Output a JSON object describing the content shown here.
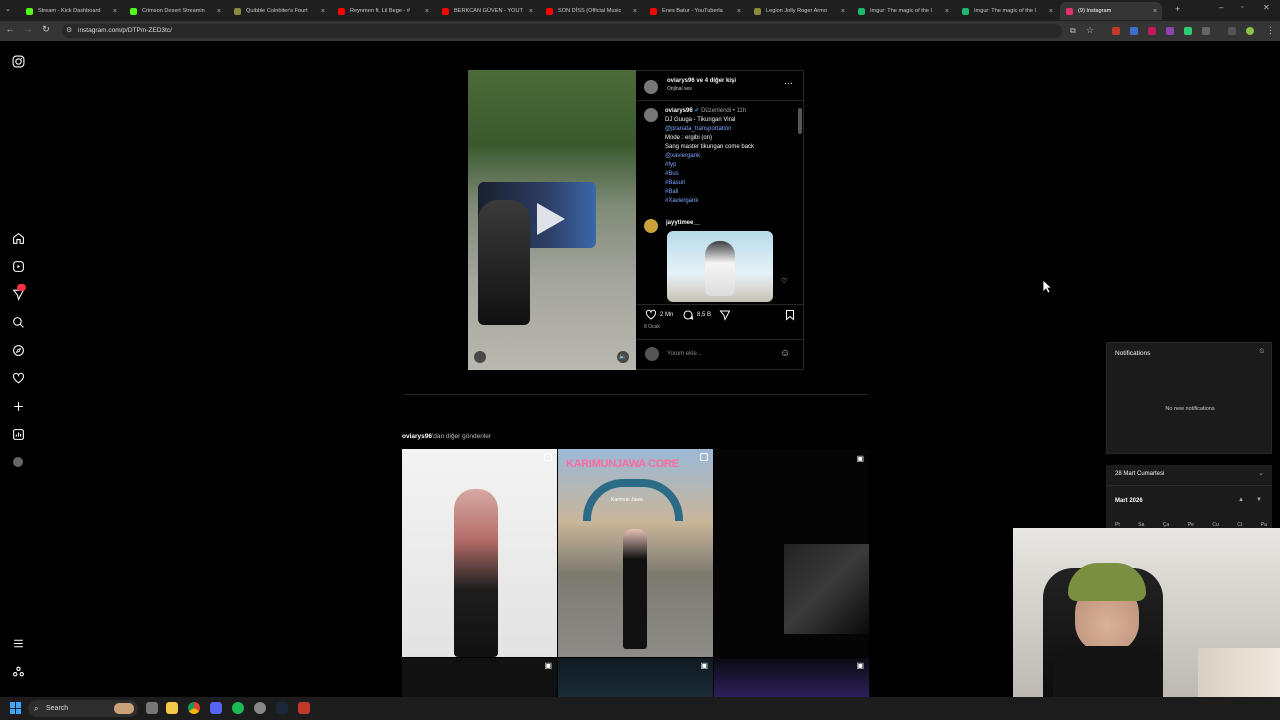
{
  "browser": {
    "tabs": [
      {
        "title": "Stream - Kick Dashboard",
        "color": "#53fc18"
      },
      {
        "title": "Crimson Desert Streamin",
        "color": "#53fc18"
      },
      {
        "title": "Quibble Colnbiter's Fourt",
        "color": "#8a8a3a"
      },
      {
        "title": "Reynmen ft. Lil Bege - #",
        "color": "#ff0000"
      },
      {
        "title": "BERKCAN GÜVEN - YOUT",
        "color": "#ff0000"
      },
      {
        "title": "SON DİSS (Official Music",
        "color": "#ff0000"
      },
      {
        "title": "Enes Batur - YouTuberla",
        "color": "#ff0000"
      },
      {
        "title": "Legion Jolly Roger Armo",
        "color": "#8a8a3a"
      },
      {
        "title": "Imgur: The magic of the I",
        "color": "#1bb76e"
      },
      {
        "title": "Imgur: The magic of the I",
        "color": "#1bb76e"
      },
      {
        "title": "(9) Instagram",
        "color": "#e1306c"
      }
    ],
    "url": "instagram.com/p/DTPm-ZED3tc/"
  },
  "post": {
    "header_user": "oviarys96 ve 4 diğer kişi",
    "header_sub": "Orijinal ses",
    "caption_user": "oviarys96",
    "caption_meta": "Düzenlendi • 11h",
    "caption_lines": [
      {
        "text": "DJ Guuga - Tikungan Viral",
        "link": false
      },
      {
        "text": "@pranata_transportation",
        "link": true
      },
      {
        "text": "Mode : ergibi (on)",
        "link": false
      },
      {
        "text": "Sang master tikungan come back",
        "link": false
      },
      {
        "text": "@xaviergank",
        "link": true
      },
      {
        "text": "#fyp",
        "link": true
      },
      {
        "text": "#Bus",
        "link": true
      },
      {
        "text": "#Basuri",
        "link": true
      },
      {
        "text": "#Bali",
        "link": true
      },
      {
        "text": "#Xaviergank",
        "link": true
      }
    ],
    "comment_user": "jayytimee__",
    "likes": "2 Mn",
    "comments": "8,5 B",
    "date": "8 Ocak",
    "comment_placeholder": "Yorum ekle..."
  },
  "more_posts": {
    "title_user": "oviarys96",
    "title_rest": "'dan diğer gönderiler",
    "banner_text": "KARIMUNJAWA CORE",
    "gate_text": "Karimun Jawa"
  },
  "notifications": {
    "title": "Notifications",
    "empty": "No new notifications",
    "date": "28 Mart Cumartesi",
    "month": "Mart 2026",
    "weekdays": [
      "Pt",
      "Sa",
      "Ça",
      "Pe",
      "Cu",
      "Ct",
      "Pa"
    ]
  },
  "taskbar": {
    "search_label": "Search"
  }
}
